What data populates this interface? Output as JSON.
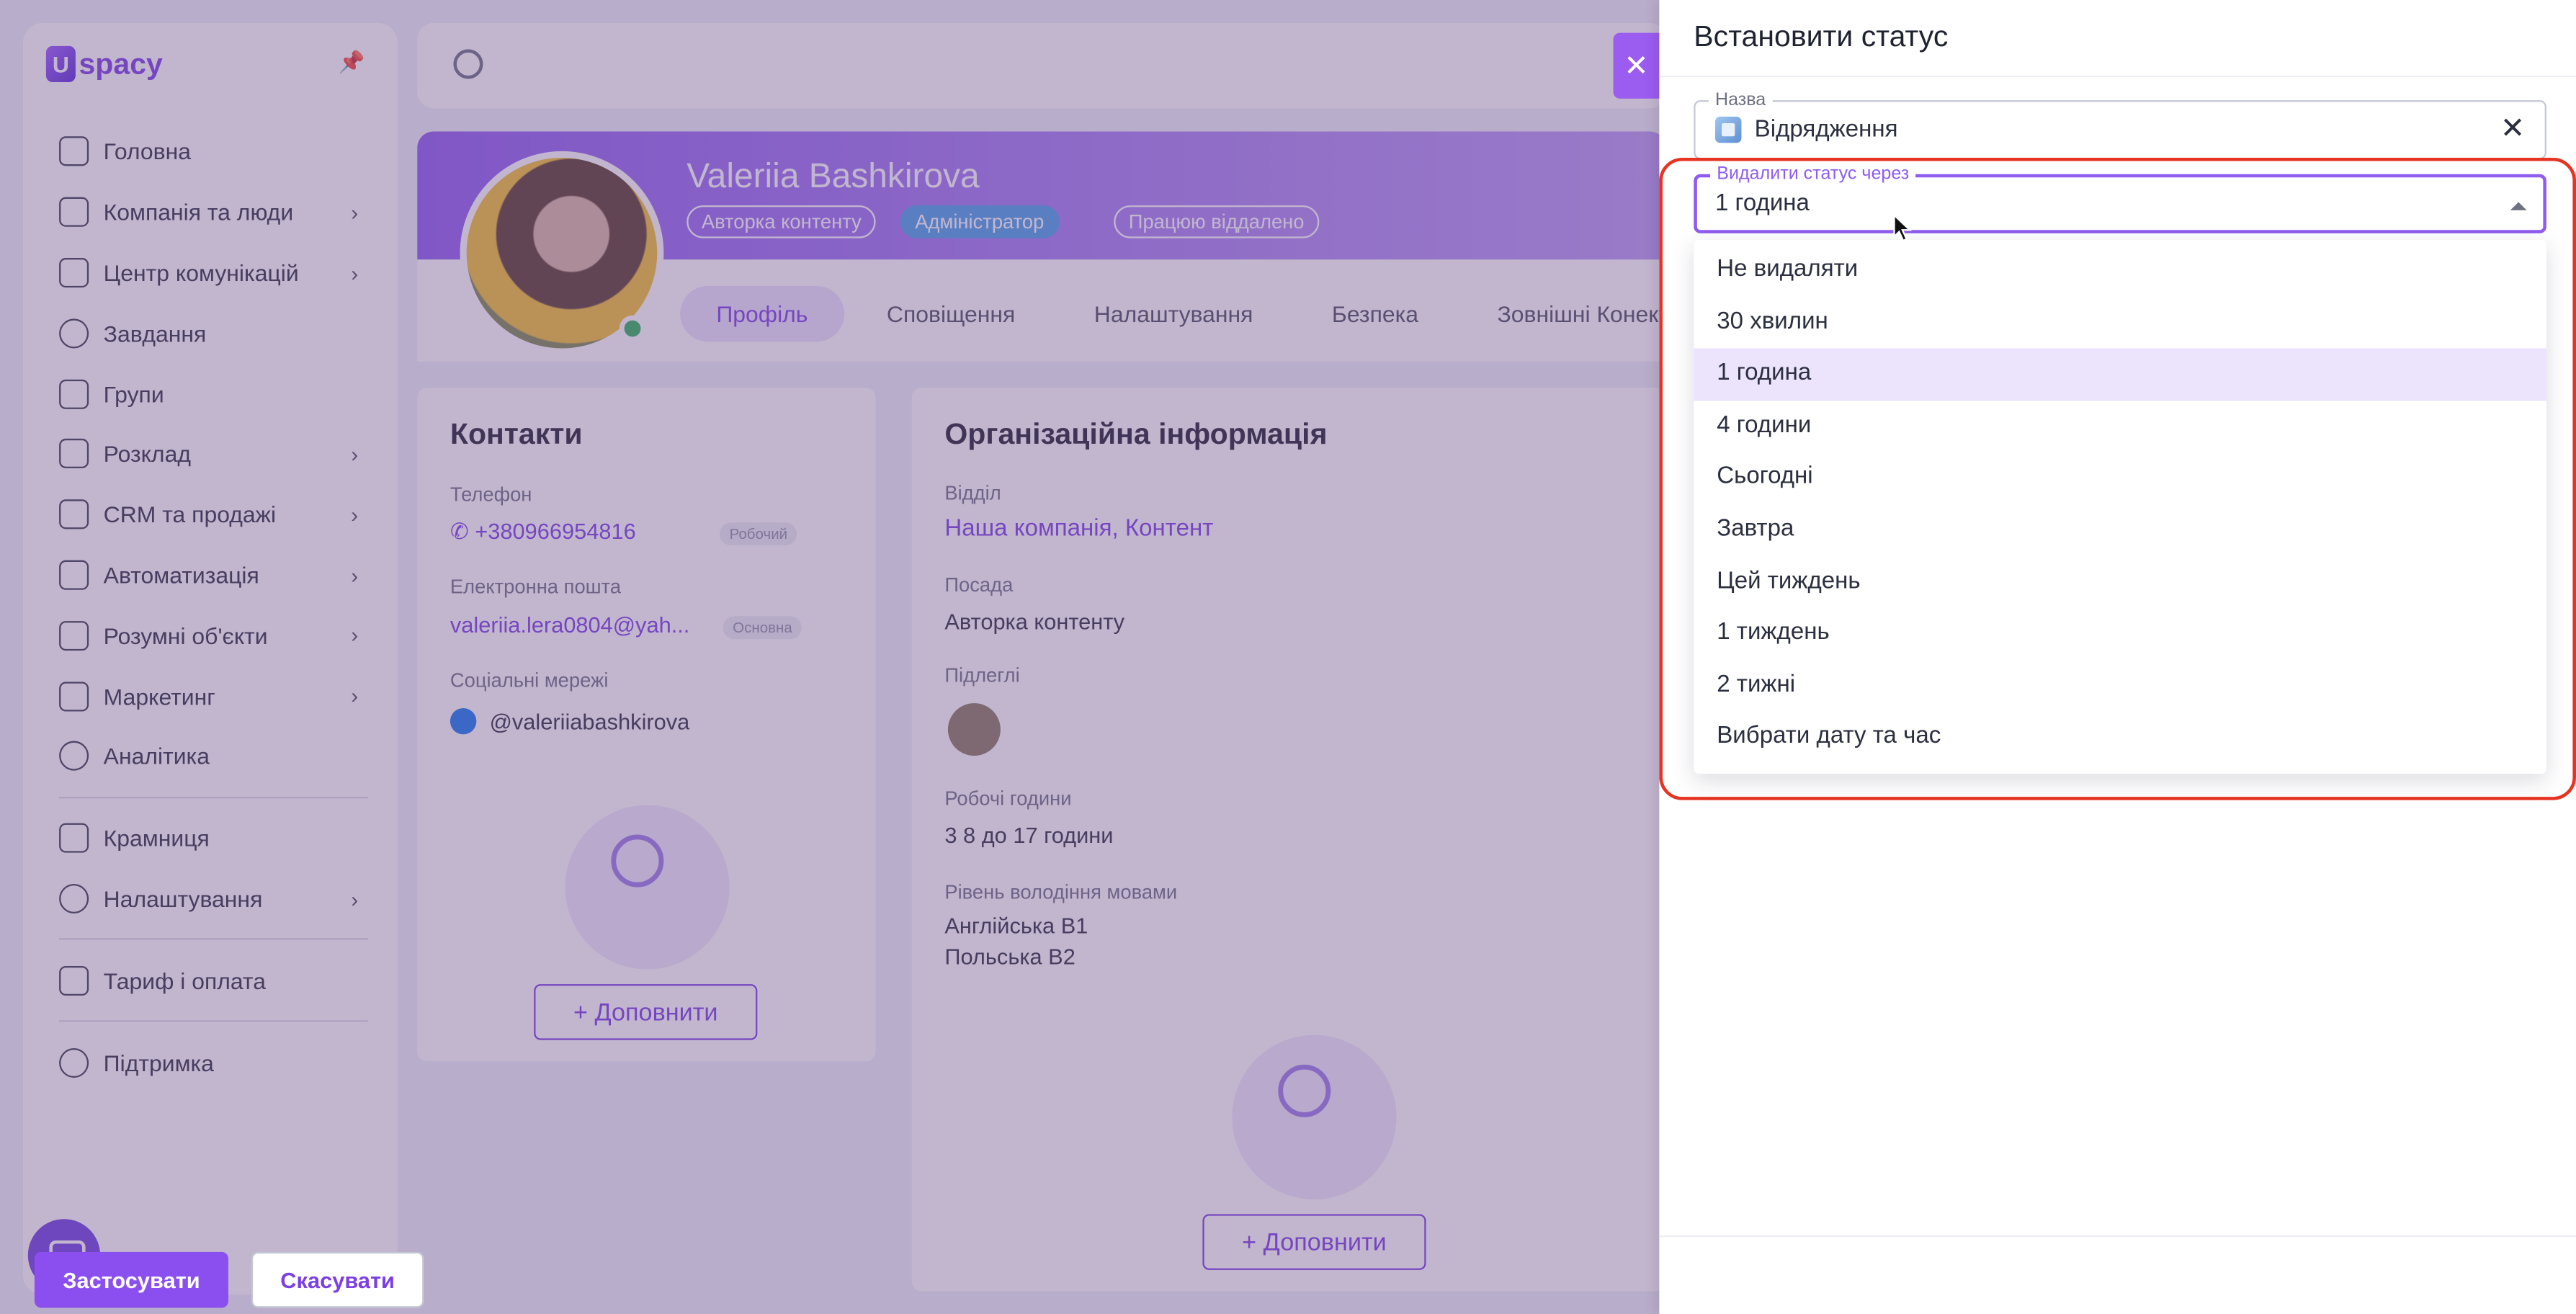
{
  "app": {
    "logo": "spacy",
    "logo_mark": "U",
    "nav": [
      {
        "label": "Головна",
        "icon": "home-icon",
        "chevron": false
      },
      {
        "label": "Компанія та люди",
        "icon": "company-icon",
        "chevron": true
      },
      {
        "label": "Центр комунікацій",
        "icon": "chat-icon",
        "chevron": true
      },
      {
        "label": "Завдання",
        "icon": "check-circle-icon",
        "chevron": false
      },
      {
        "label": "Групи",
        "icon": "users-icon",
        "chevron": false
      },
      {
        "label": "Розклад",
        "icon": "calendar-icon",
        "chevron": true
      },
      {
        "label": "CRM та продажі",
        "icon": "database-icon",
        "chevron": true
      },
      {
        "label": "Автоматизація",
        "icon": "bolt-icon",
        "chevron": true
      },
      {
        "label": "Розумні об'єкти",
        "icon": "smart-object-icon",
        "chevron": true
      },
      {
        "label": "Маркетинг",
        "icon": "marketing-icon",
        "chevron": true
      },
      {
        "label": "Аналітика",
        "icon": "analytics-icon",
        "chevron": false
      }
    ],
    "nav_bottom": [
      {
        "label": "Крамниця",
        "icon": "store-icon",
        "chevron": false
      },
      {
        "label": "Налаштування",
        "icon": "gear-icon",
        "chevron": true
      },
      {
        "label": "Тариф і оплата",
        "icon": "wallet-icon",
        "chevron": false
      },
      {
        "label": "Підтримка",
        "icon": "support-icon",
        "chevron": false
      }
    ],
    "chevron_glyph": "›"
  },
  "profile": {
    "name": "Valeriia Bashkirova",
    "tags": [
      "Авторка контенту",
      "Адміністратор",
      "Працюю віддалено"
    ],
    "tabs": [
      "Профіль",
      "Сповіщення",
      "Налаштування",
      "Безпека",
      "Зовнішні Конектори"
    ],
    "contacts": {
      "title": "Контакти",
      "phone_label": "Телефон",
      "phone": "+380966954816",
      "phone_chip": "Робочий",
      "email_label": "Електронна пошта",
      "email": "valeriia.lera0804@yah...",
      "email_chip": "Основна",
      "social_label": "Соціальні мережі",
      "social": "@valeriiabashkirova",
      "add_label": "+   Доповнити"
    },
    "org": {
      "title": "Організаційна інформація",
      "dept_label": "Відділ",
      "dept": "Наша компанія, Контент",
      "position_label": "Посада",
      "position": "Авторка контенту",
      "subordinates_label": "Підлеглі",
      "hours_label": "Робочі години",
      "hours": "3 8 до 17 години",
      "lang_label": "Рівень володіння мовами",
      "lang1": "Англійська B1",
      "lang2": "Польська B2",
      "add_label": "+   Доповнити"
    }
  },
  "panel": {
    "close_glyph": "✕",
    "title": "Встановити статус",
    "name_field": {
      "legend": "Назва",
      "value": "Відрядження",
      "clear_glyph": "✕"
    },
    "remove_field": {
      "legend": "Видалити статус через",
      "value": "1 година"
    },
    "options": [
      "Не видаляти",
      "30 хвилин",
      "1 година",
      "4 години",
      "Сьогодні",
      "Завтра",
      "Цей тиждень",
      "1 тиждень",
      "2 тижні",
      "Вибрати дату та час"
    ],
    "selected_index": 2,
    "apply_label": "Застосувати",
    "cancel_label": "Скасувати"
  },
  "colors": {
    "accent": "#8b4ff0",
    "highlight": "#e63322",
    "selected_option": "#ece3fc"
  }
}
